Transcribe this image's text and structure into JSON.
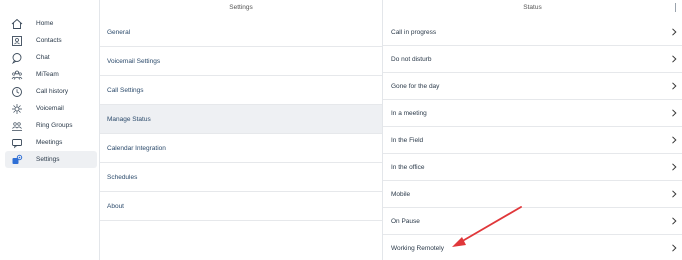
{
  "sidebar": {
    "items": [
      {
        "label": "Home",
        "icon": "home-icon"
      },
      {
        "label": "Contacts",
        "icon": "contacts-icon"
      },
      {
        "label": "Chat",
        "icon": "chat-icon"
      },
      {
        "label": "MiTeam",
        "icon": "team-icon"
      },
      {
        "label": "Call history",
        "icon": "clock-icon"
      },
      {
        "label": "Voicemail",
        "icon": "voicemail-icon"
      },
      {
        "label": "Ring Groups",
        "icon": "ring-groups-icon"
      },
      {
        "label": "Meetings",
        "icon": "meetings-icon"
      },
      {
        "label": "Settings",
        "icon": "settings-icon",
        "active": true
      }
    ]
  },
  "settings": {
    "header": "Settings",
    "items": [
      {
        "label": "General"
      },
      {
        "label": "Voicemail Settings"
      },
      {
        "label": "Call Settings"
      },
      {
        "label": "Manage Status",
        "active": true
      },
      {
        "label": "Calendar Integration"
      },
      {
        "label": "Schedules"
      },
      {
        "label": "About"
      }
    ]
  },
  "status": {
    "header": "Status",
    "items": [
      {
        "label": "Call in progress"
      },
      {
        "label": "Do not disturb"
      },
      {
        "label": "Gone for the day"
      },
      {
        "label": "In a meeting"
      },
      {
        "label": "In the Field"
      },
      {
        "label": "In the office"
      },
      {
        "label": "Mobile"
      },
      {
        "label": "On Pause"
      },
      {
        "label": "Working Remotely"
      }
    ]
  },
  "colors": {
    "accent": "#2f6fd6",
    "annotation_arrow": "#e0373a",
    "active_bg": "#eef0f3"
  }
}
